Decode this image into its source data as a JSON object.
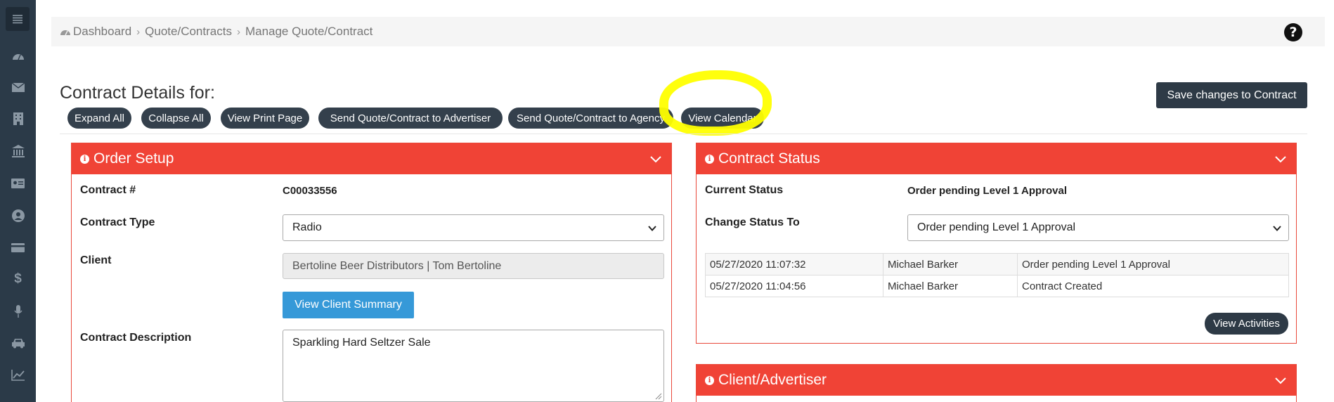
{
  "sidebar": {
    "icons": [
      "menu-icon",
      "dashboard-icon",
      "mail-icon",
      "building-icon",
      "bank-icon",
      "id-card-icon",
      "user-icon",
      "card-icon",
      "dollar-icon",
      "microphone-icon",
      "car-icon",
      "chart-icon"
    ]
  },
  "breadcrumb": {
    "items": [
      "Dashboard",
      "Quote/Contracts",
      "Manage Quote/Contract"
    ]
  },
  "header": {
    "title": "Contract Details for:",
    "save_label": "Save changes to Contract",
    "help_label": "?"
  },
  "toolbar": {
    "buttons": [
      "Expand All",
      "Collapse All",
      "View Print Page",
      "Send Quote/Contract to Advertiser",
      "Send Quote/Contract to Agency",
      "View Calendar"
    ]
  },
  "order_setup": {
    "title": "Order Setup",
    "contract_number_label": "Contract #",
    "contract_number": "C00033556",
    "contract_type_label": "Contract Type",
    "contract_type": "Radio",
    "client_label": "Client",
    "client": "Bertoline Beer Distributors | Tom Bertoline",
    "client_summary_label": "View Client Summary",
    "description_label": "Contract Description",
    "description": "Sparkling Hard Seltzer Sale"
  },
  "contract_status": {
    "title": "Contract Status",
    "current_label": "Current Status",
    "current": "Order pending Level 1 Approval",
    "change_label": "Change Status To",
    "change_value": "Order pending Level 1 Approval",
    "rows": [
      [
        "05/27/2020 11:07:32",
        "Michael Barker",
        "Order pending Level 1 Approval"
      ],
      [
        "05/27/2020 11:04:56",
        "Michael Barker",
        "Contract Created"
      ]
    ],
    "activities_label": "View Activities"
  },
  "client_advertiser": {
    "title": "Client/Advertiser"
  },
  "colors": {
    "panel_header": "#f04336",
    "sidebar": "#2b3a48",
    "dark_button": "#2e3a46",
    "primary_button": "#3699d8",
    "highlight": "#ffff00"
  }
}
